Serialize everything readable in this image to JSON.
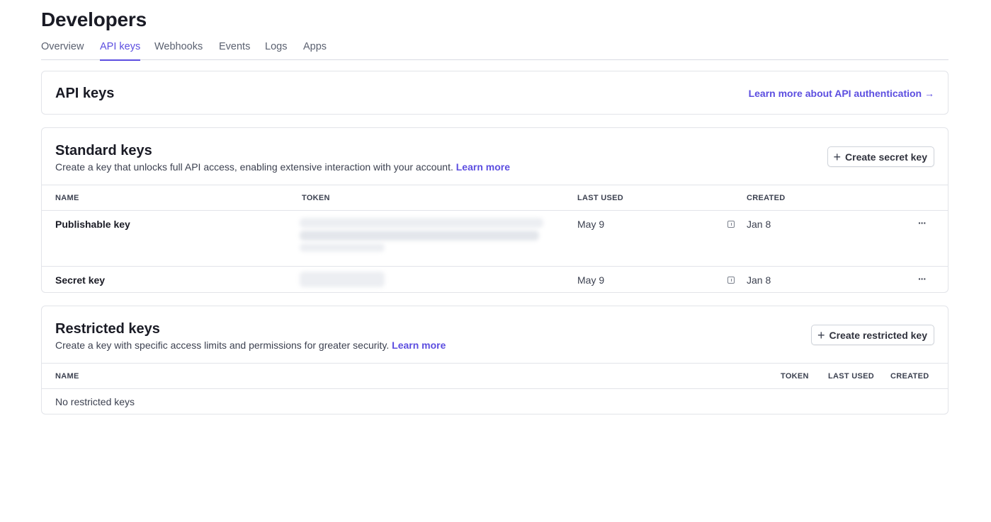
{
  "page": {
    "title": "Developers"
  },
  "tabs": [
    {
      "label": "Overview",
      "active": false
    },
    {
      "label": "API keys",
      "active": true
    },
    {
      "label": "Webhooks",
      "active": false
    },
    {
      "label": "Events",
      "active": false
    },
    {
      "label": "Logs",
      "active": false
    },
    {
      "label": "Apps",
      "active": false
    }
  ],
  "api_keys_card": {
    "title": "API keys",
    "link_label": "Learn more about API authentication",
    "link_arrow": "→"
  },
  "standard": {
    "title": "Standard keys",
    "description": "Create a key that unlocks full API access, enabling extensive interaction with your account.",
    "learn_more": "Learn more",
    "button_label": "Create secret key",
    "button_icon": "plus-icon",
    "columns": [
      "NAME",
      "TOKEN",
      "LAST USED",
      "CREATED"
    ],
    "rows": [
      {
        "name": "Publishable key",
        "last_used": "May 9",
        "created": "Jan 8",
        "more": "···"
      },
      {
        "name": "Secret key",
        "last_used": "May 9",
        "created": "Jan 8",
        "more": "···"
      }
    ]
  },
  "restricted": {
    "title": "Restricted keys",
    "description": "Create a key with specific access limits and permissions for greater security.",
    "learn_more": "Learn more",
    "button_label": "Create restricted key",
    "button_icon": "plus-icon",
    "columns": [
      "NAME",
      "TOKEN",
      "LAST USED",
      "CREATED"
    ],
    "empty_text": "No restricted keys"
  },
  "colors": {
    "accent": "#5c4ee0",
    "border": "#e2e4e9",
    "text": "#1a1b25",
    "muted": "#3c4150"
  }
}
